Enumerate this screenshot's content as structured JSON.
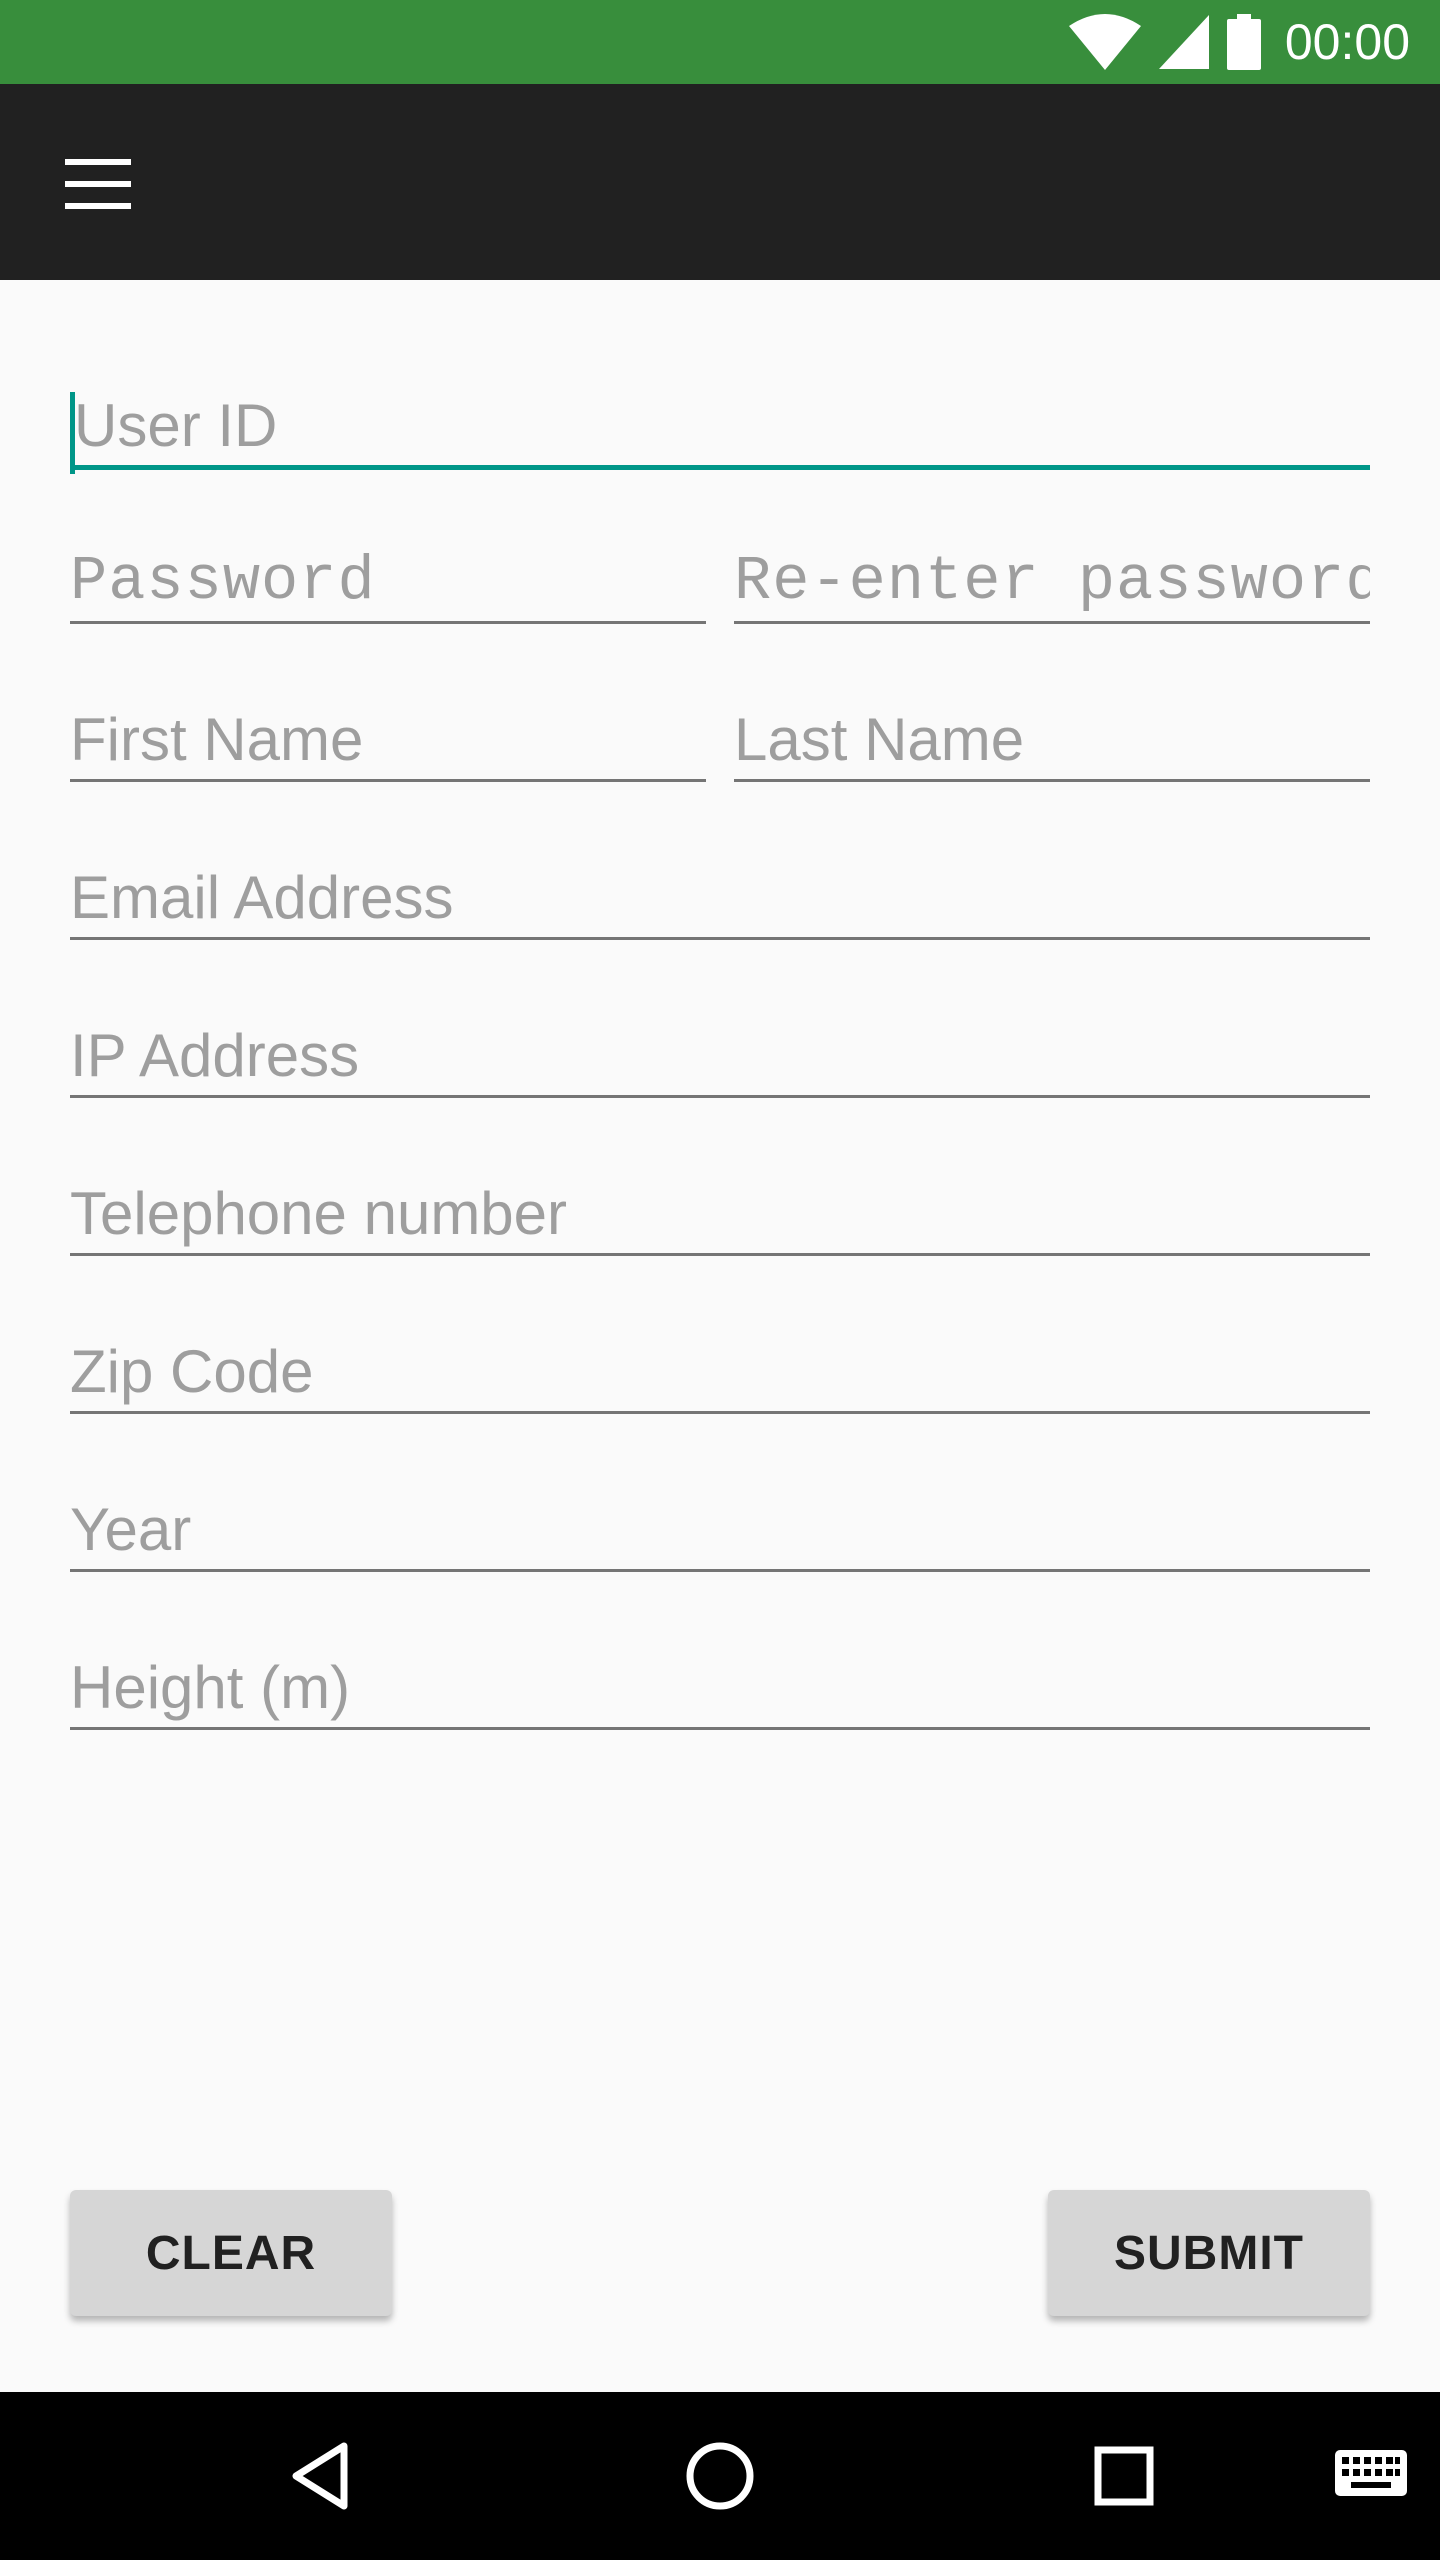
{
  "status_bar": {
    "time": "00:00",
    "icons": [
      "wifi-icon",
      "signal-icon",
      "battery-icon"
    ],
    "color": "#388e3c"
  },
  "toolbar": {
    "menu_icon": "hamburger-menu-icon",
    "color": "#212121"
  },
  "form": {
    "user_id": {
      "placeholder": "User ID",
      "value": ""
    },
    "password": {
      "placeholder": "Password",
      "value": ""
    },
    "reenter_password": {
      "placeholder": "Re-enter password",
      "value": ""
    },
    "first_name": {
      "placeholder": "First Name",
      "value": ""
    },
    "last_name": {
      "placeholder": "Last Name",
      "value": ""
    },
    "email": {
      "placeholder": "Email Address",
      "value": ""
    },
    "ip_address": {
      "placeholder": "IP Address",
      "value": ""
    },
    "telephone": {
      "placeholder": "Telephone number",
      "value": ""
    },
    "zip_code": {
      "placeholder": "Zip Code",
      "value": ""
    },
    "year": {
      "placeholder": "Year",
      "value": ""
    },
    "height": {
      "placeholder": "Height (m)",
      "value": ""
    },
    "accent_color": "#009688"
  },
  "buttons": {
    "clear_label": "CLEAR",
    "submit_label": "SUBMIT"
  },
  "nav_bar": {
    "icons": [
      "back-icon",
      "home-icon",
      "recents-icon",
      "keyboard-icon"
    ]
  }
}
